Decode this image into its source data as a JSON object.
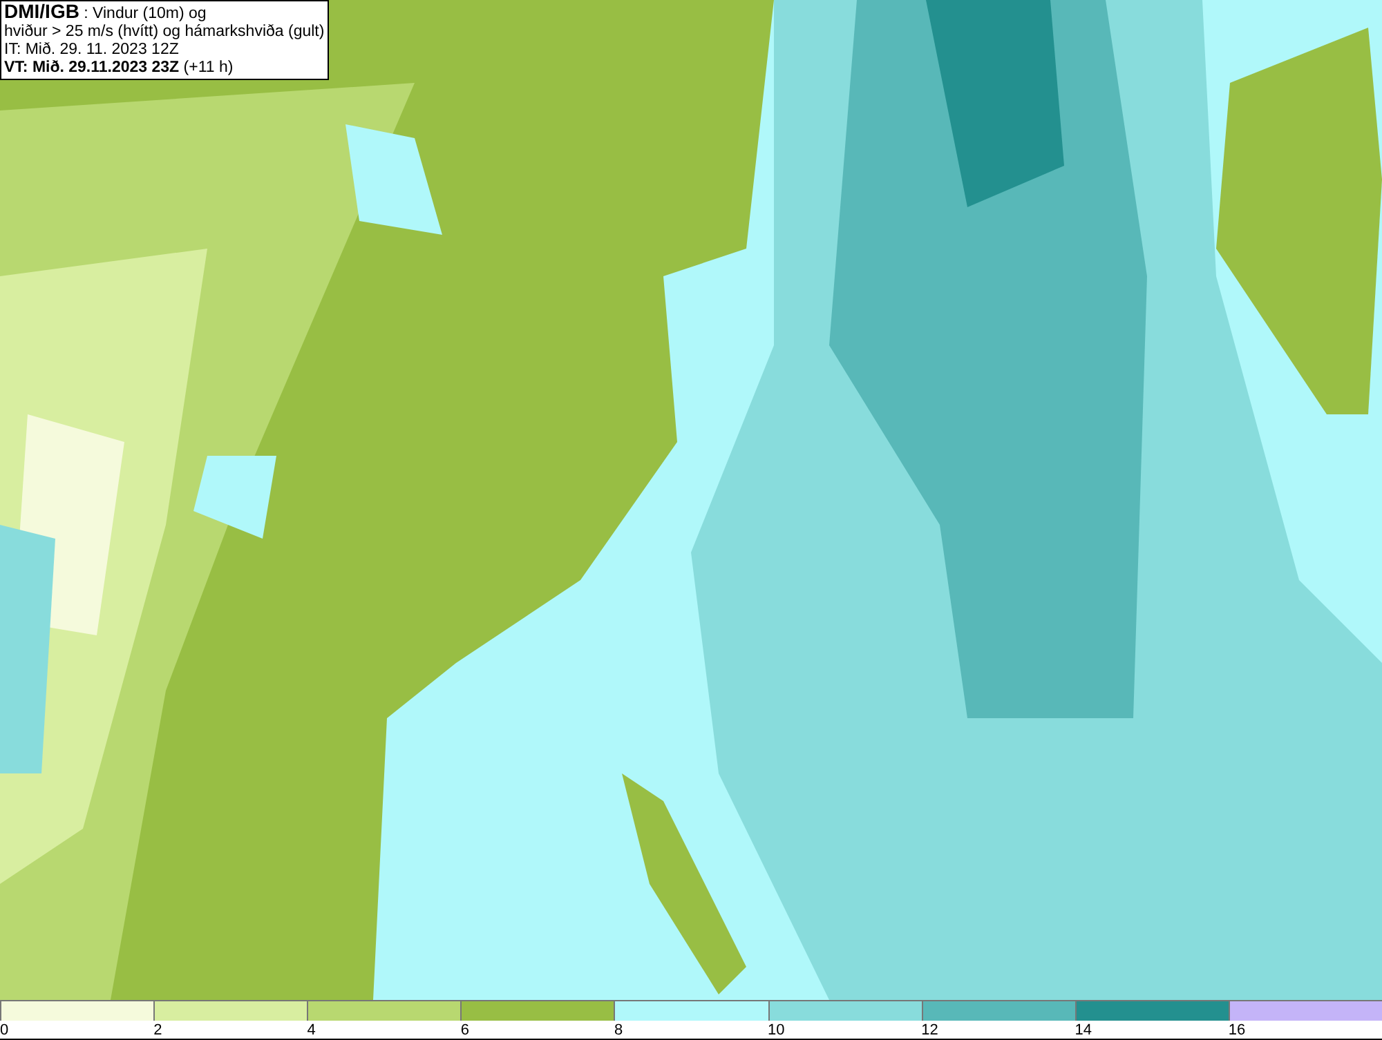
{
  "info_box": {
    "lines": [
      "**DMI/IGB** : Vindur (10m) og",
      "hviður > 25 m/s (hvítt) og hámarkshviða (gult)",
      "IT: Mið. 29. 11. 2023 12Z",
      "**VT: Mið. 29.11.2023 23Z** (+11 h)"
    ]
  },
  "legend": {
    "segments": [
      {
        "label": "0",
        "color": "#f5fadc"
      },
      {
        "label": "2",
        "color": "#d8eea0"
      },
      {
        "label": "4",
        "color": "#b8d870"
      },
      {
        "label": "6",
        "color": "#98be44"
      },
      {
        "label": "8",
        "color": "#b0f8fa"
      },
      {
        "label": "10",
        "color": "#88dcdc"
      },
      {
        "label": "12",
        "color": "#58b8b8"
      },
      {
        "label": "14",
        "color": "#23908f"
      },
      {
        "label": "16",
        "color": "#c4b4f8"
      }
    ]
  }
}
